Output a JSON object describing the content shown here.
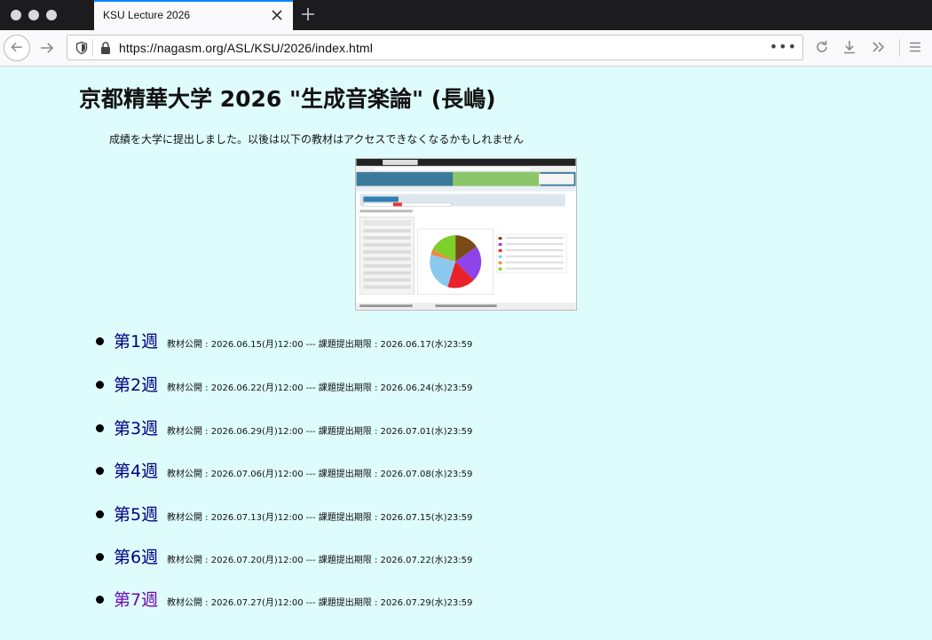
{
  "browser": {
    "tab_title": "KSU Lecture 2026",
    "url": "https://nagasm.org/ASL/KSU/2026/index.html",
    "accent_color": "#0a84ff"
  },
  "page": {
    "title": "京都精華大学 2026 \"生成音楽論\" (長嶋)",
    "notice": "成績を大学に提出しました。以後は以下の教材はアクセスできなくなるかもしれません",
    "background_color": "#dffcfd",
    "weeks": [
      {
        "label": "第1週",
        "info": "教材公開 : 2026.06.15(月)12:00 --- 課題提出期限 : 2026.06.17(水)23:59",
        "visited": false
      },
      {
        "label": "第2週",
        "info": "教材公開 : 2026.06.22(月)12:00 --- 課題提出期限 : 2026.06.24(水)23:59",
        "visited": false
      },
      {
        "label": "第3週",
        "info": "教材公開 : 2026.06.29(月)12:00 --- 課題提出期限 : 2026.07.01(水)23:59",
        "visited": false
      },
      {
        "label": "第4週",
        "info": "教材公開 : 2026.07.06(月)12:00 --- 課題提出期限 : 2026.07.08(水)23:59",
        "visited": false
      },
      {
        "label": "第5週",
        "info": "教材公開 : 2026.07.13(月)12:00 --- 課題提出期限 : 2026.07.15(水)23:59",
        "visited": false
      },
      {
        "label": "第6週",
        "info": "教材公開 : 2026.07.20(月)12:00 --- 課題提出期限 : 2026.07.22(水)23:59",
        "visited": false
      },
      {
        "label": "第7週",
        "info": "教材公開 : 2026.07.27(月)12:00 --- 課題提出期限 : 2026.07.29(水)23:59",
        "visited": true
      }
    ],
    "link_color": "#000080",
    "visited_link_color": "#6b0ab8"
  },
  "icons": {
    "back": "arrow-left-icon",
    "forward": "arrow-right-icon",
    "reload": "reload-icon",
    "download": "download-icon",
    "overflow": "chevrons-right-icon",
    "menu": "hamburger-menu-icon"
  }
}
